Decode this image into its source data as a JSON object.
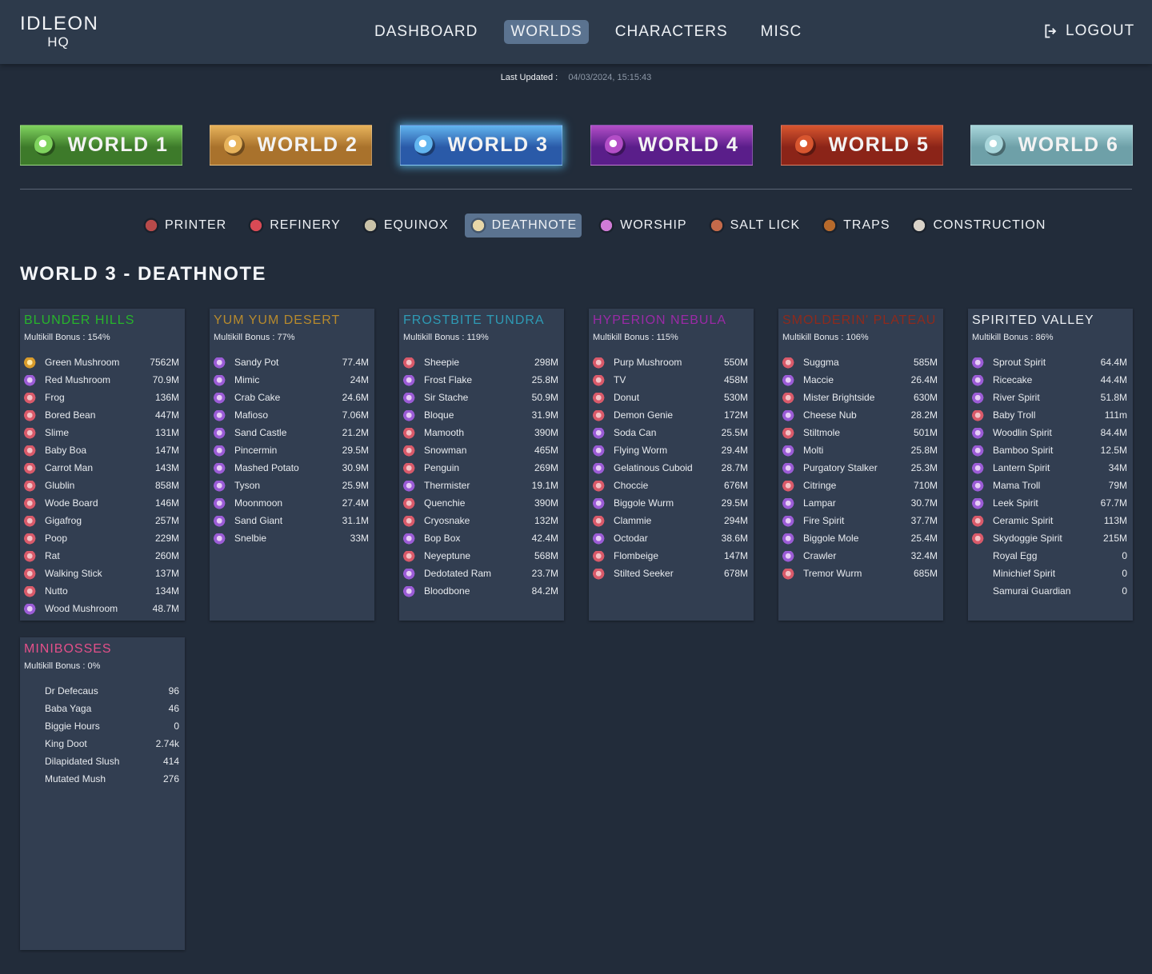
{
  "header": {
    "logo_line1": "IDLEON",
    "logo_line2": "HQ",
    "nav": [
      "DASHBOARD",
      "WORLDS",
      "CHARACTERS",
      "MISC"
    ],
    "nav_active": "WORLDS",
    "logout_label": "LOGOUT"
  },
  "updated": {
    "label": "Last Updated :",
    "value": "04/03/2024, 15:15:43"
  },
  "worlds": [
    {
      "label": "WORLD 1",
      "color": "#3d7a2a",
      "accent": "#7fd35e"
    },
    {
      "label": "WORLD 2",
      "color": "#a9722c",
      "accent": "#e7b35b"
    },
    {
      "label": "WORLD 3",
      "color": "#2a5aa8",
      "accent": "#62b5ef",
      "active": true
    },
    {
      "label": "WORLD 4",
      "color": "#5a1e8a",
      "accent": "#b34ec7"
    },
    {
      "label": "WORLD 5",
      "color": "#8b2418",
      "accent": "#d8562f"
    },
    {
      "label": "WORLD 6",
      "color": "#6ea0a8",
      "accent": "#a8d6db"
    }
  ],
  "subtabs": [
    {
      "label": "PRINTER",
      "icon": "printer-icon"
    },
    {
      "label": "REFINERY",
      "icon": "refinery-icon"
    },
    {
      "label": "EQUINOX",
      "icon": "equinox-icon"
    },
    {
      "label": "DEATHNOTE",
      "icon": "deathnote-icon",
      "active": true
    },
    {
      "label": "WORSHIP",
      "icon": "worship-icon"
    },
    {
      "label": "SALT LICK",
      "icon": "salt-lick-icon"
    },
    {
      "label": "TRAPS",
      "icon": "traps-icon"
    },
    {
      "label": "CONSTRUCTION",
      "icon": "construction-icon"
    }
  ],
  "page_title": "WORLD 3 - DEATHNOTE",
  "cards": [
    {
      "title": "BLUNDER HILLS",
      "title_color": "#27b42b",
      "bonus": "Multikill Bonus : 154%",
      "rows": [
        [
          "Green Mushroom",
          "7562M",
          "gold"
        ],
        [
          "Red Mushroom",
          "70.9M",
          "purple"
        ],
        [
          "Frog",
          "136M",
          "red"
        ],
        [
          "Bored Bean",
          "447M",
          "red"
        ],
        [
          "Slime",
          "131M",
          "red"
        ],
        [
          "Baby Boa",
          "147M",
          "red"
        ],
        [
          "Carrot Man",
          "143M",
          "red"
        ],
        [
          "Glublin",
          "858M",
          "red"
        ],
        [
          "Wode Board",
          "146M",
          "red"
        ],
        [
          "Gigafrog",
          "257M",
          "red"
        ],
        [
          "Poop",
          "229M",
          "red"
        ],
        [
          "Rat",
          "260M",
          "red"
        ],
        [
          "Walking Stick",
          "137M",
          "red"
        ],
        [
          "Nutto",
          "134M",
          "red"
        ],
        [
          "Wood Mushroom",
          "48.7M",
          "purple"
        ]
      ]
    },
    {
      "title": "YUM YUM DESERT",
      "title_color": "#b78a2d",
      "bonus": "Multikill Bonus : 77%",
      "rows": [
        [
          "Sandy Pot",
          "77.4M",
          "purple"
        ],
        [
          "Mimic",
          "24M",
          "purple"
        ],
        [
          "Crab Cake",
          "24.6M",
          "purple"
        ],
        [
          "Mafioso",
          "7.06M",
          "purple"
        ],
        [
          "Sand Castle",
          "21.2M",
          "purple"
        ],
        [
          "Pincermin",
          "29.5M",
          "purple"
        ],
        [
          "Mashed Potato",
          "30.9M",
          "purple"
        ],
        [
          "Tyson",
          "25.9M",
          "purple"
        ],
        [
          "Moonmoon",
          "27.4M",
          "purple"
        ],
        [
          "Sand Giant",
          "31.1M",
          "purple"
        ],
        [
          "Snelbie",
          "33M",
          "purple"
        ]
      ]
    },
    {
      "title": "FROSTBITE TUNDRA",
      "title_color": "#2e9bb5",
      "bonus": "Multikill Bonus : 119%",
      "rows": [
        [
          "Sheepie",
          "298M",
          "red"
        ],
        [
          "Frost Flake",
          "25.8M",
          "purple"
        ],
        [
          "Sir Stache",
          "50.9M",
          "purple"
        ],
        [
          "Bloque",
          "31.9M",
          "purple"
        ],
        [
          "Mamooth",
          "390M",
          "red"
        ],
        [
          "Snowman",
          "465M",
          "red"
        ],
        [
          "Penguin",
          "269M",
          "red"
        ],
        [
          "Thermister",
          "19.1M",
          "purple"
        ],
        [
          "Quenchie",
          "390M",
          "red"
        ],
        [
          "Cryosnake",
          "132M",
          "red"
        ],
        [
          "Bop Box",
          "42.4M",
          "purple"
        ],
        [
          "Neyeptune",
          "568M",
          "red"
        ],
        [
          "Dedotated Ram",
          "23.7M",
          "purple"
        ],
        [
          "Bloodbone",
          "84.2M",
          "purple"
        ]
      ]
    },
    {
      "title": "HYPERION NEBULA",
      "title_color": "#9a2aa6",
      "bonus": "Multikill Bonus : 115%",
      "rows": [
        [
          "Purp Mushroom",
          "550M",
          "red"
        ],
        [
          "TV",
          "458M",
          "red"
        ],
        [
          "Donut",
          "530M",
          "red"
        ],
        [
          "Demon Genie",
          "172M",
          "red"
        ],
        [
          "Soda Can",
          "25.5M",
          "purple"
        ],
        [
          "Flying Worm",
          "29.4M",
          "purple"
        ],
        [
          "Gelatinous Cuboid",
          "28.7M",
          "purple"
        ],
        [
          "Choccie",
          "676M",
          "red"
        ],
        [
          "Biggole Wurm",
          "29.5M",
          "purple"
        ],
        [
          "Clammie",
          "294M",
          "red"
        ],
        [
          "Octodar",
          "38.6M",
          "purple"
        ],
        [
          "Flombeige",
          "147M",
          "red"
        ],
        [
          "Stilted Seeker",
          "678M",
          "red"
        ]
      ]
    },
    {
      "title": "SMOLDERIN' PLATEAU",
      "title_color": "#8e2a1c",
      "bonus": "Multikill Bonus : 106%",
      "rows": [
        [
          "Suggma",
          "585M",
          "red"
        ],
        [
          "Maccie",
          "26.4M",
          "purple"
        ],
        [
          "Mister Brightside",
          "630M",
          "red"
        ],
        [
          "Cheese Nub",
          "28.2M",
          "purple"
        ],
        [
          "Stiltmole",
          "501M",
          "red"
        ],
        [
          "Molti",
          "25.8M",
          "purple"
        ],
        [
          "Purgatory Stalker",
          "25.3M",
          "purple"
        ],
        [
          "Citringe",
          "710M",
          "red"
        ],
        [
          "Lampar",
          "30.7M",
          "purple"
        ],
        [
          "Fire Spirit",
          "37.7M",
          "purple"
        ],
        [
          "Biggole Mole",
          "25.4M",
          "purple"
        ],
        [
          "Crawler",
          "32.4M",
          "purple"
        ],
        [
          "Tremor Wurm",
          "685M",
          "red"
        ]
      ]
    },
    {
      "title": "SPIRITED VALLEY",
      "title_color": "#eef1f5",
      "bonus": "Multikill Bonus : 86%",
      "rows": [
        [
          "Sprout Spirit",
          "64.4M",
          "purple"
        ],
        [
          "Ricecake",
          "44.4M",
          "purple"
        ],
        [
          "River Spirit",
          "51.8M",
          "purple"
        ],
        [
          "Baby Troll",
          "111m",
          "red"
        ],
        [
          "Woodlin Spirit",
          "84.4M",
          "purple"
        ],
        [
          "Bamboo Spirit",
          "12.5M",
          "purple"
        ],
        [
          "Lantern Spirit",
          "34M",
          "purple"
        ],
        [
          "Mama Troll",
          "79M",
          "purple"
        ],
        [
          "Leek Spirit",
          "67.7M",
          "purple"
        ],
        [
          "Ceramic Spirit",
          "113M",
          "red"
        ],
        [
          "Skydoggie Spirit",
          "215M",
          "red"
        ],
        [
          "Royal Egg",
          "0",
          ""
        ],
        [
          "Minichief Spirit",
          "0",
          ""
        ],
        [
          "Samurai Guardian",
          "0",
          ""
        ]
      ]
    },
    {
      "title": "MINIBOSSES",
      "title_color": "#e5508a",
      "bonus": "Multikill Bonus : 0%",
      "rows": [
        [
          "Dr Defecaus",
          "96",
          ""
        ],
        [
          "Baba Yaga",
          "46",
          ""
        ],
        [
          "Biggie Hours",
          "0",
          ""
        ],
        [
          "King Doot",
          "2.74k",
          ""
        ],
        [
          "Dilapidated Slush",
          "414",
          ""
        ],
        [
          "Mutated Mush",
          "276",
          ""
        ]
      ]
    }
  ]
}
